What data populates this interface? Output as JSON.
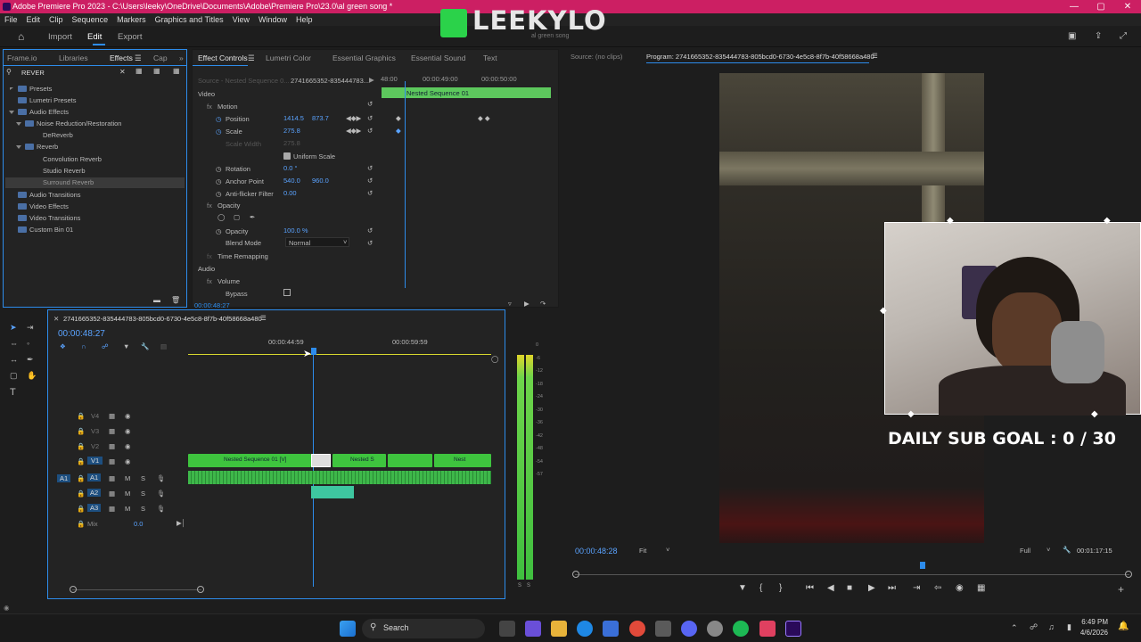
{
  "titlebar": {
    "text": "Adobe Premiere Pro 2023 - C:\\Users\\leeky\\OneDrive\\Documents\\Adobe\\Premiere Pro\\23.0\\al green song *"
  },
  "menu": [
    "File",
    "Edit",
    "Clip",
    "Sequence",
    "Markers",
    "Graphics and Titles",
    "View",
    "Window",
    "Help"
  ],
  "overlay": {
    "logo": "LEEKYLO",
    "logo_sub": "al green song",
    "goal": "DAILY SUB GOAL : 0 / 30"
  },
  "workspace": {
    "import": "Import",
    "edit": "Edit",
    "export": "Export"
  },
  "project_panel": {
    "tabs": [
      "Frame.io",
      "Libraries",
      "Effects",
      "Cap"
    ],
    "search_value": "REVER",
    "tree": [
      "Presets",
      "Lumetri Presets",
      "Audio Effects",
      "Noise Reduction/Restoration",
      "DeReverb",
      "Reverb",
      "Convolution Reverb",
      "Studio Reverb",
      "Surround Reverb",
      "Audio Transitions",
      "Video Effects",
      "Video Transitions",
      "Custom Bin 01"
    ]
  },
  "effect_controls": {
    "tabs": [
      "Effect Controls",
      "Lumetri Color",
      "Essential Graphics",
      "Essential Sound",
      "Text"
    ],
    "source": "Source - Nested Sequence 0...",
    "clip": "2741665352-835444783...",
    "times": [
      "48:00",
      "00:00:49:00",
      "00:00:50:00"
    ],
    "clip_bar": "Nested Sequence 01",
    "section_video": "Video",
    "motion": "Motion",
    "position_label": "Position",
    "position_x": "1414.5",
    "position_y": "873.7",
    "scale_label": "Scale",
    "scale_value": "275.8",
    "scale_width_label": "Scale Width",
    "scale_width_value": "275.8",
    "uniform_scale": "Uniform Scale",
    "rotation_label": "Rotation",
    "rotation_value": "0.0 °",
    "anchor_label": "Anchor Point",
    "anchor_x": "540.0",
    "anchor_y": "960.0",
    "antiflicker_label": "Anti-flicker Filter",
    "antiflicker_value": "0.00",
    "opacity_section": "Opacity",
    "opacity_label": "Opacity",
    "opacity_value": "100.0 %",
    "blend_label": "Blend Mode",
    "blend_value": "Normal",
    "time_remap": "Time Remapping",
    "section_audio": "Audio",
    "volume": "Volume",
    "bypass": "Bypass",
    "footer_time": "00:00:48:27"
  },
  "program": {
    "source_tab": "Source: (no clips)",
    "program_tab": "Program: 2741665352-835444783-805bcd0-6730-4e5c8-8f7b-40f58668a480",
    "timecode": "00:00:48:28",
    "fit": "Fit",
    "full": "Full",
    "duration": "00:01:17:15"
  },
  "timeline": {
    "tab": "2741665352-835444783-805bcd0-6730-4e5c8-8f7b-40f58668a480",
    "timecode": "00:00:48:27",
    "ruler": [
      "00:00:44:59",
      "00:00:59:59"
    ],
    "tracks_v": [
      "V4",
      "V3",
      "V2",
      "V1"
    ],
    "tracks_a": [
      "A1",
      "A2",
      "A3"
    ],
    "mix": "Mix",
    "mix_value": "0.0",
    "clip1": "Nested Sequence 01 [V]",
    "clip2": "Nested S",
    "clip3": "Nest",
    "track_mute": "M",
    "track_solo": "S",
    "link_a1": "A1"
  },
  "meter": {
    "ticks": [
      "0",
      "-6",
      "-12",
      "-18",
      "-24",
      "-30",
      "-36",
      "-42",
      "-48",
      "-54",
      "-57"
    ],
    "solo": "S",
    "solo2": "S"
  },
  "taskbar": {
    "search": "Search",
    "time": "6:49 PM",
    "date": "4/6/2026"
  },
  "colors": {
    "accent": "#cc1f63",
    "green": "#3ec43e",
    "blue": "#2d8ceb"
  }
}
